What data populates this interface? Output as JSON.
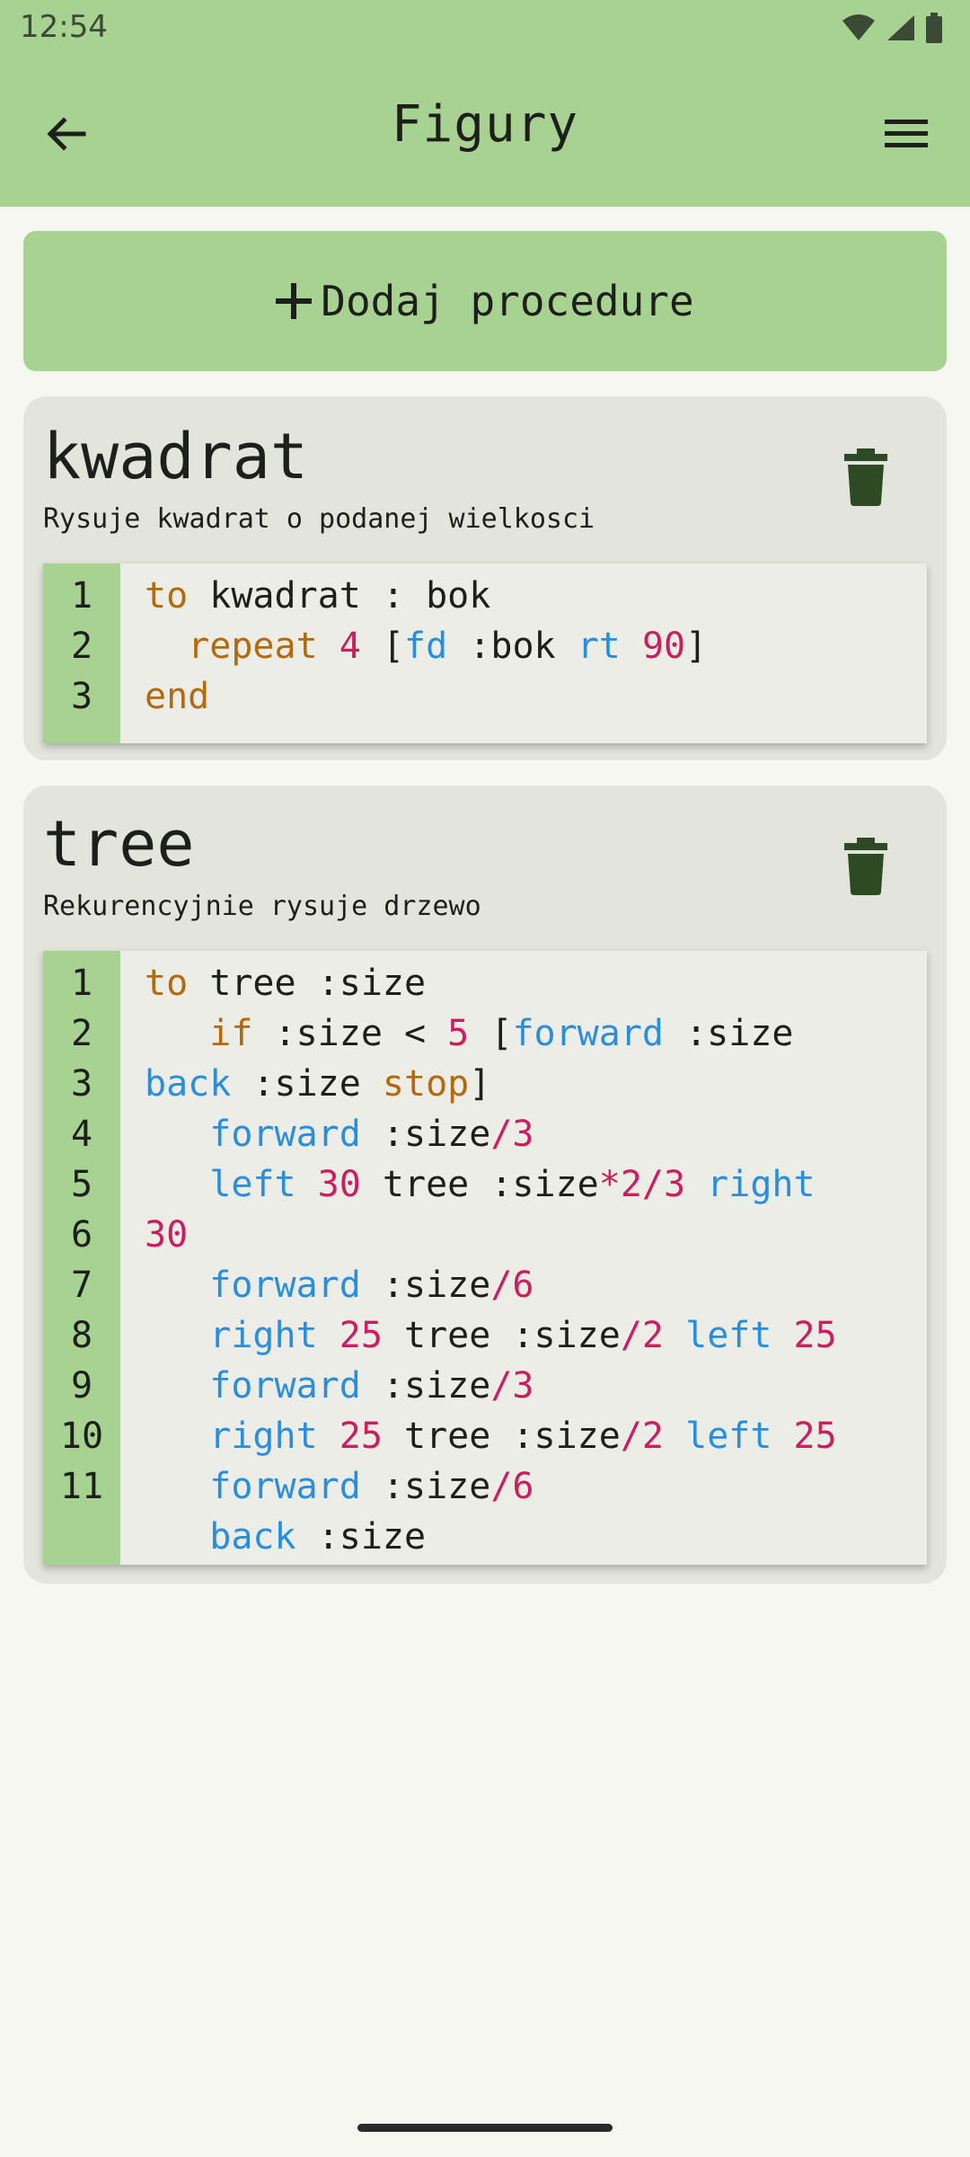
{
  "status_bar": {
    "time": "12:54"
  },
  "app_bar": {
    "title": "Figury"
  },
  "add_button": {
    "label": "Dodaj procedure"
  },
  "procedures": [
    {
      "title": "kwadrat",
      "description": "Rysuje kwadrat o podanej wielkosci",
      "line_numbers": [
        "1",
        "2",
        "3"
      ]
    },
    {
      "title": "tree",
      "description": "Rekurencyjnie rysuje drzewo",
      "line_numbers": [
        "1",
        "2",
        "3",
        "4",
        "5",
        "6",
        "7",
        "8",
        "9",
        "10",
        "11"
      ]
    }
  ],
  "colors": {
    "accent": "#a8d292",
    "keyword": "#b46a0a",
    "command": "#2a8ee0",
    "number": "#cc1d5e",
    "delete_icon": "#2e4a24"
  }
}
